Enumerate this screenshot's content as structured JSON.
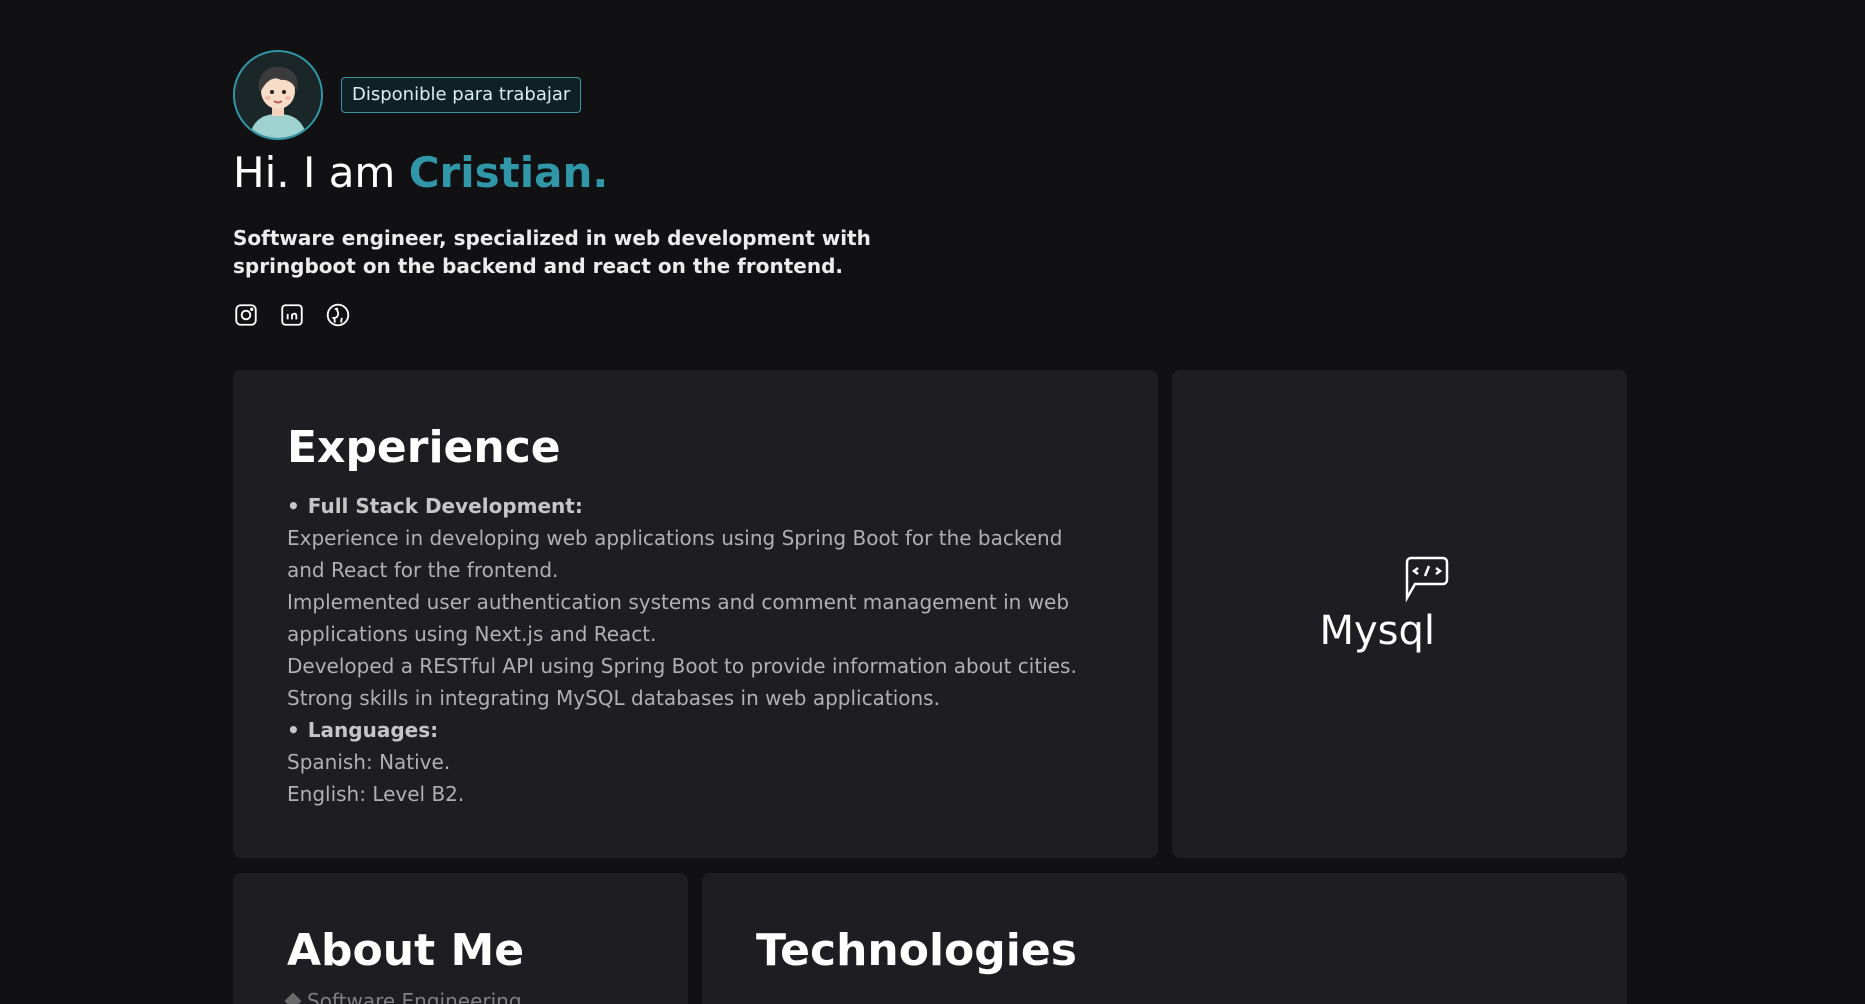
{
  "hero": {
    "badge": "Disponible para trabajar",
    "greeting": "Hi. I am",
    "name": "Cristian.",
    "description": "Software engineer, specialized in web development with springboot on the backend and react on the frontend.",
    "socials": [
      "instagram-icon",
      "linkedin-icon",
      "github-icon"
    ]
  },
  "experience": {
    "title": "Experience",
    "sections": [
      {
        "heading": "Full Stack Development:",
        "lines": [
          "Experience in developing web applications using Spring Boot for the backend and React for the frontend.",
          "Implemented user authentication systems and comment management in web applications using Next.js and React.",
          "Developed a RESTful API using Spring Boot to provide information about cities.",
          "Strong skills in integrating MySQL databases in web applications."
        ]
      },
      {
        "heading": "Languages:",
        "lines": [
          "Spanish: Native.",
          "English: Level B2."
        ]
      }
    ]
  },
  "tech_highlight": {
    "icon": "code-message-icon",
    "label": "Mysql"
  },
  "about": {
    "title": "About Me",
    "first_item": "Software Engineering"
  },
  "technologies": {
    "title": "Technologies"
  },
  "colors": {
    "accent": "#2f97a8",
    "background": "#111113",
    "card": "#1e1d22"
  }
}
